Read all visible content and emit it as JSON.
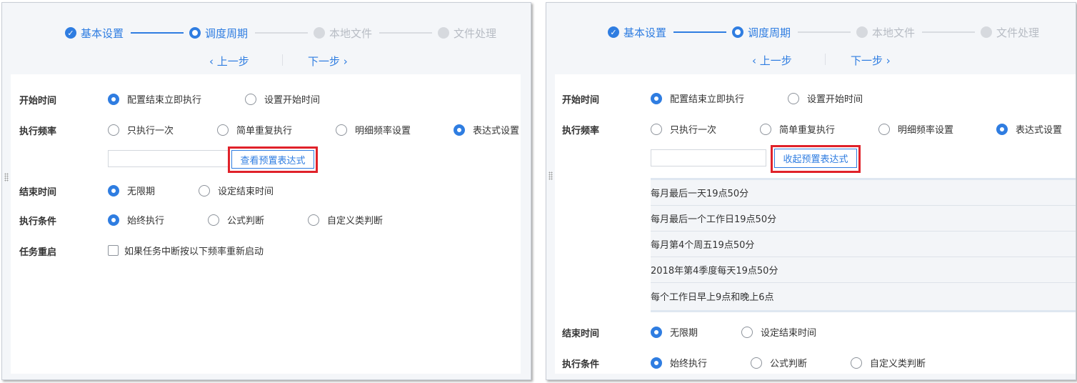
{
  "steps": [
    {
      "label": "基本设置",
      "state": "done",
      "icon": "check-icon"
    },
    {
      "label": "调度周期",
      "state": "active"
    },
    {
      "label": "本地文件",
      "state": "todo"
    },
    {
      "label": "文件处理",
      "state": "todo"
    }
  ],
  "nav": {
    "prev": "‹ 上一步",
    "next": "下一步 ›"
  },
  "labels": {
    "start_time": "开始时间",
    "frequency": "执行频率",
    "end_time": "结束时间",
    "condition": "执行条件",
    "restart": "任务重启"
  },
  "start_time_options": [
    {
      "label": "配置结束立即执行",
      "checked": true
    },
    {
      "label": "设置开始时间",
      "checked": false
    }
  ],
  "frequency_options": [
    {
      "label": "只执行一次",
      "checked": false
    },
    {
      "label": "简单重复执行",
      "checked": false
    },
    {
      "label": "明细频率设置",
      "checked": false
    },
    {
      "label": "表达式设置",
      "checked": true
    }
  ],
  "end_time_options": [
    {
      "label": "无限期",
      "checked": true
    },
    {
      "label": "设定结束时间",
      "checked": false
    }
  ],
  "condition_options": [
    {
      "label": "始终执行",
      "checked": true
    },
    {
      "label": "公式判断",
      "checked": false
    },
    {
      "label": "自定义类判断",
      "checked": false
    }
  ],
  "restart_checkbox": {
    "label": "如果任务中断按以下频率重新启动",
    "checked": false
  },
  "expression_input": {
    "value": ""
  },
  "left_button": "查看预置表达式",
  "right_button": "收起预置表达式",
  "presets": [
    "每月最后一天19点50分",
    "每月最后一个工作日19点50分",
    "每月第4个周五19点50分",
    "2018年第4季度每天19点50分",
    "每个工作日早上9点和晚上6点"
  ],
  "colors": {
    "accent": "#2f7de1",
    "highlight": "#e0222a",
    "todo": "#d6d9de"
  }
}
